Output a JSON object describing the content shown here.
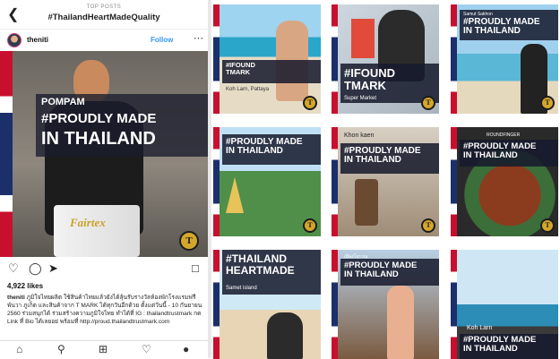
{
  "header": {
    "subtitle": "TOP POSTS",
    "title": "#ThailandHeartMadeQuality",
    "back_icon": "chevron-left-icon"
  },
  "post": {
    "username": "theniti",
    "follow_label": "Follow",
    "more_icon": "more-horizontal-icon",
    "overlay_name": "POMPAM",
    "overlay_line1": "#PROUDLY MADE",
    "overlay_line2": "IN THAILAND",
    "shorts_brand": "Fairtex",
    "badge_letter": "T",
    "likes": "4,922 likes",
    "caption_user": "theniti",
    "caption_text": "ภูมิใจไทยผลิต ใช้สินค้าไทยแล้วยังได้ลุ้นรับรางวัลห้องพักโรงแรมฟรีพันวา ภูเก็ต และสินค้าจาก T MARK ได้ทุกวันอีกด้วย ตั้งแต่วันนี้ - 10 กันยายน 2560 ร่วมสนุกได้ ร่วมสร้างความภูมิใจไทย ทำได้ที่ IG : thailandtrustmark กด Link ที่ Bio ได้เลยอย่ พร้อมที่ http://proud.thailandtrustmark.com"
  },
  "actions": {
    "like_icon": "heart-icon",
    "comment_icon": "comment-icon",
    "share_icon": "share-icon",
    "save_icon": "bookmark-icon"
  },
  "bottom_nav": [
    "home-icon",
    "search-icon",
    "add-icon",
    "activity-heart-icon",
    "profile-icon"
  ],
  "tiles": [
    {
      "title": "#IFOUND\nTMARK",
      "location": "Koh Larn, Pattaya"
    },
    {
      "title": "#IFOUND\nTMARK",
      "location": "Super Market"
    },
    {
      "title": "#PROUDLY MADE\nIN THAILAND",
      "location": "Samut Sakhon",
      "badge": "T"
    },
    {
      "title": "#PROUDLY MADE\nIN THAILAND",
      "location": ""
    },
    {
      "title": "#PROUDLY MADE\nIN THAILAND",
      "location": "Khon kaen"
    },
    {
      "title": "#PROUDLY MADE\nIN THAILAND",
      "location": "ROUNDFINGER"
    },
    {
      "title": "#THAILAND\nHEARTMADE",
      "location": "Samet island"
    },
    {
      "title": "#PROUDLY MADE\nIN THAILAND",
      "location": "เมืองโบราณ"
    },
    {
      "title": "#PROUDLY MADE\nIN THAILAND",
      "location": "Koh Larn"
    }
  ],
  "colors": {
    "follow": "#3897f0",
    "band": "#161a2c",
    "flag_red": "#c8102e",
    "flag_blue": "#1b2f6b",
    "badge_gold": "#d4a72c"
  }
}
